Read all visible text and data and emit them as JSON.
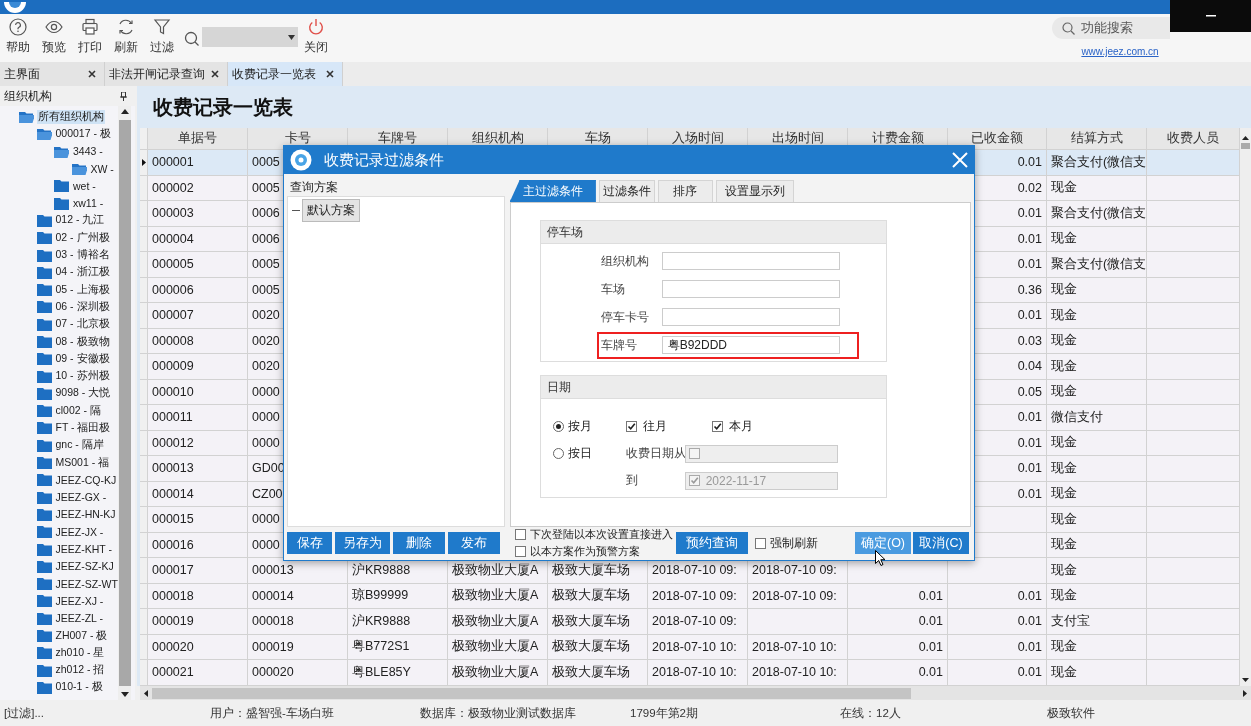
{
  "toolbar": {
    "buttons": [
      {
        "kind": "help",
        "label": "帮助"
      },
      {
        "kind": "preview",
        "label": "预览"
      },
      {
        "kind": "print",
        "label": "打印"
      },
      {
        "kind": "refresh",
        "label": "刷新"
      },
      {
        "kind": "filter",
        "label": "过滤"
      },
      {
        "kind": "close",
        "label": "关闭"
      }
    ],
    "search": {
      "placeholder": "功能搜索"
    },
    "link": "www.jeez.com.cn"
  },
  "tabs": [
    {
      "label": "主界面",
      "selected": false
    },
    {
      "label": "非法开闸记录查询",
      "selected": false
    },
    {
      "label": "收费记录一览表",
      "selected": true
    }
  ],
  "sidebar": {
    "title": "组织机构",
    "tree": [
      {
        "label": "所有组织机构",
        "selected": true,
        "expanded": true,
        "children": [
          {
            "label": "000017 - 极",
            "selected": false,
            "expanded": true,
            "children": [
              {
                "label": "3443 -",
                "selected": false,
                "expanded": true,
                "children": [
                  {
                    "label": "XW -",
                    "selected": false,
                    "expanded": true
                  }
                ]
              },
              {
                "label": "wet -",
                "selected": false,
                "expanded": false
              },
              {
                "label": "xw11 -",
                "selected": false,
                "expanded": false
              }
            ]
          },
          {
            "label": "012 - 九江",
            "selected": false,
            "expanded": false
          },
          {
            "label": "02 - 广州极",
            "selected": false,
            "expanded": false
          },
          {
            "label": "03 - 博裕名",
            "selected": false,
            "expanded": false
          },
          {
            "label": "04 - 浙江极",
            "selected": false,
            "expanded": false
          },
          {
            "label": "05 - 上海极",
            "selected": false,
            "expanded": false
          },
          {
            "label": "06 - 深圳极",
            "selected": false,
            "expanded": false
          },
          {
            "label": "07 - 北京极",
            "selected": false,
            "expanded": false
          },
          {
            "label": "08 - 极致物",
            "selected": false,
            "expanded": false
          },
          {
            "label": "09 - 安徽极",
            "selected": false,
            "expanded": false
          },
          {
            "label": "10 - 苏州极",
            "selected": false,
            "expanded": false
          },
          {
            "label": "9098 - 大悦",
            "selected": false,
            "expanded": false
          },
          {
            "label": "cl002 - 隔",
            "selected": false,
            "expanded": false
          },
          {
            "label": "FT - 福田极",
            "selected": false,
            "expanded": false
          },
          {
            "label": "gnc - 隔岸",
            "selected": false,
            "expanded": false
          },
          {
            "label": "MS001 - 福",
            "selected": false,
            "expanded": false
          },
          {
            "label": "JEEZ-CQ-KJ",
            "selected": false,
            "expanded": false
          },
          {
            "label": "JEEZ-GX -",
            "selected": false,
            "expanded": false
          },
          {
            "label": "JEEZ-HN-KJ",
            "selected": false,
            "expanded": false
          },
          {
            "label": "JEEZ-JX -",
            "selected": false,
            "expanded": false
          },
          {
            "label": "JEEZ-KHT -",
            "selected": false,
            "expanded": false
          },
          {
            "label": "JEEZ-SZ-KJ",
            "selected": false,
            "expanded": false
          },
          {
            "label": "JEEZ-SZ-WT",
            "selected": false,
            "expanded": false
          },
          {
            "label": "JEEZ-XJ -",
            "selected": false,
            "expanded": false
          },
          {
            "label": "JEEZ-ZL -",
            "selected": false,
            "expanded": false
          },
          {
            "label": "ZH007 - 极",
            "selected": false,
            "expanded": false
          },
          {
            "label": "zh010 - 星",
            "selected": false,
            "expanded": false
          },
          {
            "label": "zh012 - 招",
            "selected": false,
            "expanded": false
          },
          {
            "label": "010-1 - 极",
            "selected": false,
            "expanded": false
          }
        ]
      }
    ]
  },
  "page_title": "收费记录一览表",
  "table": {
    "columns": [
      {
        "label": "单据号",
        "kind": "text"
      },
      {
        "label": "卡号",
        "kind": "text"
      },
      {
        "label": "车牌号",
        "kind": "text"
      },
      {
        "label": "组织机构",
        "kind": "text"
      },
      {
        "label": "车场",
        "kind": "text"
      },
      {
        "label": "入场时间",
        "kind": "text"
      },
      {
        "label": "出场时间",
        "kind": "text"
      },
      {
        "label": "计费金额",
        "kind": "amount"
      },
      {
        "label": "已收金额",
        "kind": "amount"
      },
      {
        "label": "结算方式",
        "kind": "text"
      },
      {
        "label": "收费人员",
        "kind": "text"
      }
    ],
    "rows": [
      {
        "selected": true,
        "cells": [
          "000001",
          "0005",
          null,
          null,
          null,
          null,
          null,
          null,
          "0.01",
          "聚合支付(微信支",
          null
        ]
      },
      {
        "selected": false,
        "cells": [
          "000002",
          "0005",
          null,
          null,
          null,
          null,
          null,
          null,
          "0.02",
          "现金",
          null
        ]
      },
      {
        "selected": false,
        "cells": [
          "000003",
          "0006",
          null,
          null,
          null,
          null,
          null,
          null,
          "0.01",
          "聚合支付(微信支",
          null
        ]
      },
      {
        "selected": false,
        "cells": [
          "000004",
          "0006",
          null,
          null,
          null,
          null,
          null,
          null,
          "0.01",
          "现金",
          null
        ]
      },
      {
        "selected": false,
        "cells": [
          "000005",
          "0005",
          null,
          null,
          null,
          null,
          null,
          null,
          "0.01",
          "聚合支付(微信支",
          null
        ]
      },
      {
        "selected": false,
        "cells": [
          "000006",
          "0005",
          null,
          null,
          null,
          null,
          null,
          null,
          "0.36",
          "现金",
          null
        ]
      },
      {
        "selected": false,
        "cells": [
          "000007",
          "0020",
          null,
          null,
          null,
          null,
          null,
          null,
          "0.01",
          "现金",
          null
        ]
      },
      {
        "selected": false,
        "cells": [
          "000008",
          "0020",
          null,
          null,
          null,
          null,
          null,
          null,
          "0.03",
          "现金",
          null
        ]
      },
      {
        "selected": false,
        "cells": [
          "000009",
          "0020",
          null,
          null,
          null,
          null,
          null,
          null,
          "0.04",
          "现金",
          null
        ]
      },
      {
        "selected": false,
        "cells": [
          "000010",
          "0000",
          null,
          null,
          null,
          null,
          null,
          null,
          "0.05",
          "现金",
          null
        ]
      },
      {
        "selected": false,
        "cells": [
          "000011",
          "0000",
          null,
          null,
          null,
          null,
          null,
          null,
          "0.01",
          "微信支付",
          null
        ]
      },
      {
        "selected": false,
        "cells": [
          "000012",
          "0000",
          null,
          null,
          null,
          null,
          null,
          null,
          "0.01",
          "现金",
          null
        ]
      },
      {
        "selected": false,
        "cells": [
          "000013",
          "GD00",
          null,
          null,
          null,
          null,
          null,
          null,
          "0.01",
          "现金",
          null
        ]
      },
      {
        "selected": false,
        "cells": [
          "000014",
          "CZ00",
          null,
          null,
          null,
          null,
          null,
          null,
          "0.01",
          "现金",
          null
        ]
      },
      {
        "selected": false,
        "cells": [
          "000015",
          "0000",
          null,
          null,
          null,
          null,
          null,
          null,
          null,
          "现金",
          null
        ]
      },
      {
        "selected": false,
        "cells": [
          "000016",
          "0000",
          null,
          null,
          null,
          null,
          null,
          null,
          null,
          "现金",
          null
        ]
      },
      {
        "selected": false,
        "cells": [
          "000017",
          "000013",
          "沪KR9888",
          "极致物业大厦A",
          "极致大厦车场",
          "2018-07-10 09:",
          "2018-07-10 09:",
          null,
          null,
          "现金",
          null
        ]
      },
      {
        "selected": false,
        "cells": [
          "000018",
          "000014",
          "琼B99999",
          "极致物业大厦A",
          "极致大厦车场",
          "2018-07-10 09:",
          "2018-07-10 09:",
          "0.01",
          "0.01",
          "现金",
          null
        ]
      },
      {
        "selected": false,
        "cells": [
          "000019",
          "000018",
          "沪KR9888",
          "极致物业大厦A",
          "极致大厦车场",
          "2018-07-10 09:",
          null,
          "0.01",
          "0.01",
          "支付宝",
          null
        ]
      },
      {
        "selected": false,
        "cells": [
          "000020",
          "000019",
          "粤B772S1",
          "极致物业大厦A",
          "极致大厦车场",
          "2018-07-10 10:",
          "2018-07-10 10:",
          "0.01",
          "0.01",
          "现金",
          null
        ]
      },
      {
        "selected": false,
        "cells": [
          "000021",
          "000020",
          "粤BLE85Y",
          "极致物业大厦A",
          "极致大厦车场",
          "2018-07-10 10:",
          "2018-07-10 10:",
          "0.01",
          "0.01",
          "现金",
          null
        ]
      }
    ]
  },
  "dialog": {
    "title": "收费记录过滤条件",
    "schemes": {
      "title": "查询方案",
      "items": [
        {
          "label": "默认方案",
          "selected": true
        }
      ]
    },
    "tabs": [
      {
        "label": "主过滤条件",
        "selected": true
      },
      {
        "label": "过滤条件",
        "selected": false
      },
      {
        "label": "排序",
        "selected": false
      },
      {
        "label": "设置显示列",
        "selected": false
      }
    ],
    "parking": {
      "title": "停车场",
      "fields": [
        {
          "label": "组织机构",
          "highlighted": false
        },
        {
          "label": "车场",
          "highlighted": false
        },
        {
          "label": "停车卡号",
          "highlighted": false
        },
        {
          "label": "车牌号",
          "value": "粤B92DDD",
          "highlighted": true
        }
      ]
    },
    "date": {
      "title": "日期",
      "modes": [
        {
          "label": "按月",
          "selected": true
        },
        {
          "label": "按日",
          "selected": false
        }
      ],
      "month_options": [
        {
          "label": "往月",
          "checked": true
        },
        {
          "label": "本月",
          "checked": true
        }
      ],
      "from": {
        "label": "收费日期从",
        "checked": false,
        "disabled": true
      },
      "to": {
        "label": "到",
        "checked": true,
        "value": "2022-11-17",
        "disabled": true
      }
    },
    "scheme_buttons": [
      "保存",
      "另存为",
      "删除",
      "发布"
    ],
    "options": [
      {
        "label": "下次登陆以本次设置直接进入",
        "checked": false
      },
      {
        "label": "以本方案作为预警方案",
        "checked": false
      }
    ],
    "reserve_button": "预约查询",
    "force_refresh": {
      "label": "强制刷新",
      "checked": false
    },
    "ok_button": {
      "label": "确定(O)",
      "hovered": true
    },
    "cancel_button": "取消(C)"
  },
  "status_bar": [
    "[过滤]...",
    "用户：盛智强-车场白班",
    "数据库：极致物业测试数据库",
    "1799年第2期",
    "在线：12人",
    "极致软件"
  ]
}
